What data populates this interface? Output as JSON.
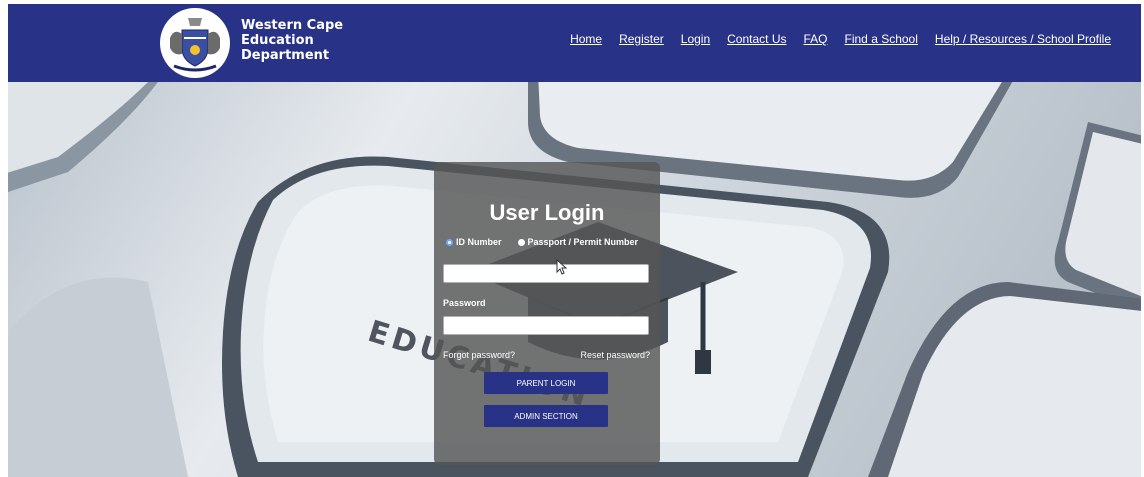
{
  "header": {
    "brand_lines": [
      "Western Cape",
      "Education",
      "Department"
    ],
    "logo_icon": "coat-of-arms-icon",
    "nav": [
      "Home",
      "Register",
      "Login",
      "Contact Us",
      "FAQ",
      "Find a School",
      "Help / Resources / School Profile"
    ],
    "bg_color": "#283286"
  },
  "hero": {
    "keycap_text": "EDUCATION",
    "keycap_icon": "graduation-cap-icon"
  },
  "login": {
    "title": "User Login",
    "radio_id": "ID Number",
    "radio_passport": "Passport / Permit Number",
    "id_value": "",
    "password_label": "Password",
    "password_value": "",
    "forgot": "Forgot password?",
    "reset": "Reset password?",
    "parent_login": "PARENT LOGIN",
    "admin_section": "ADMIN SECTION"
  }
}
